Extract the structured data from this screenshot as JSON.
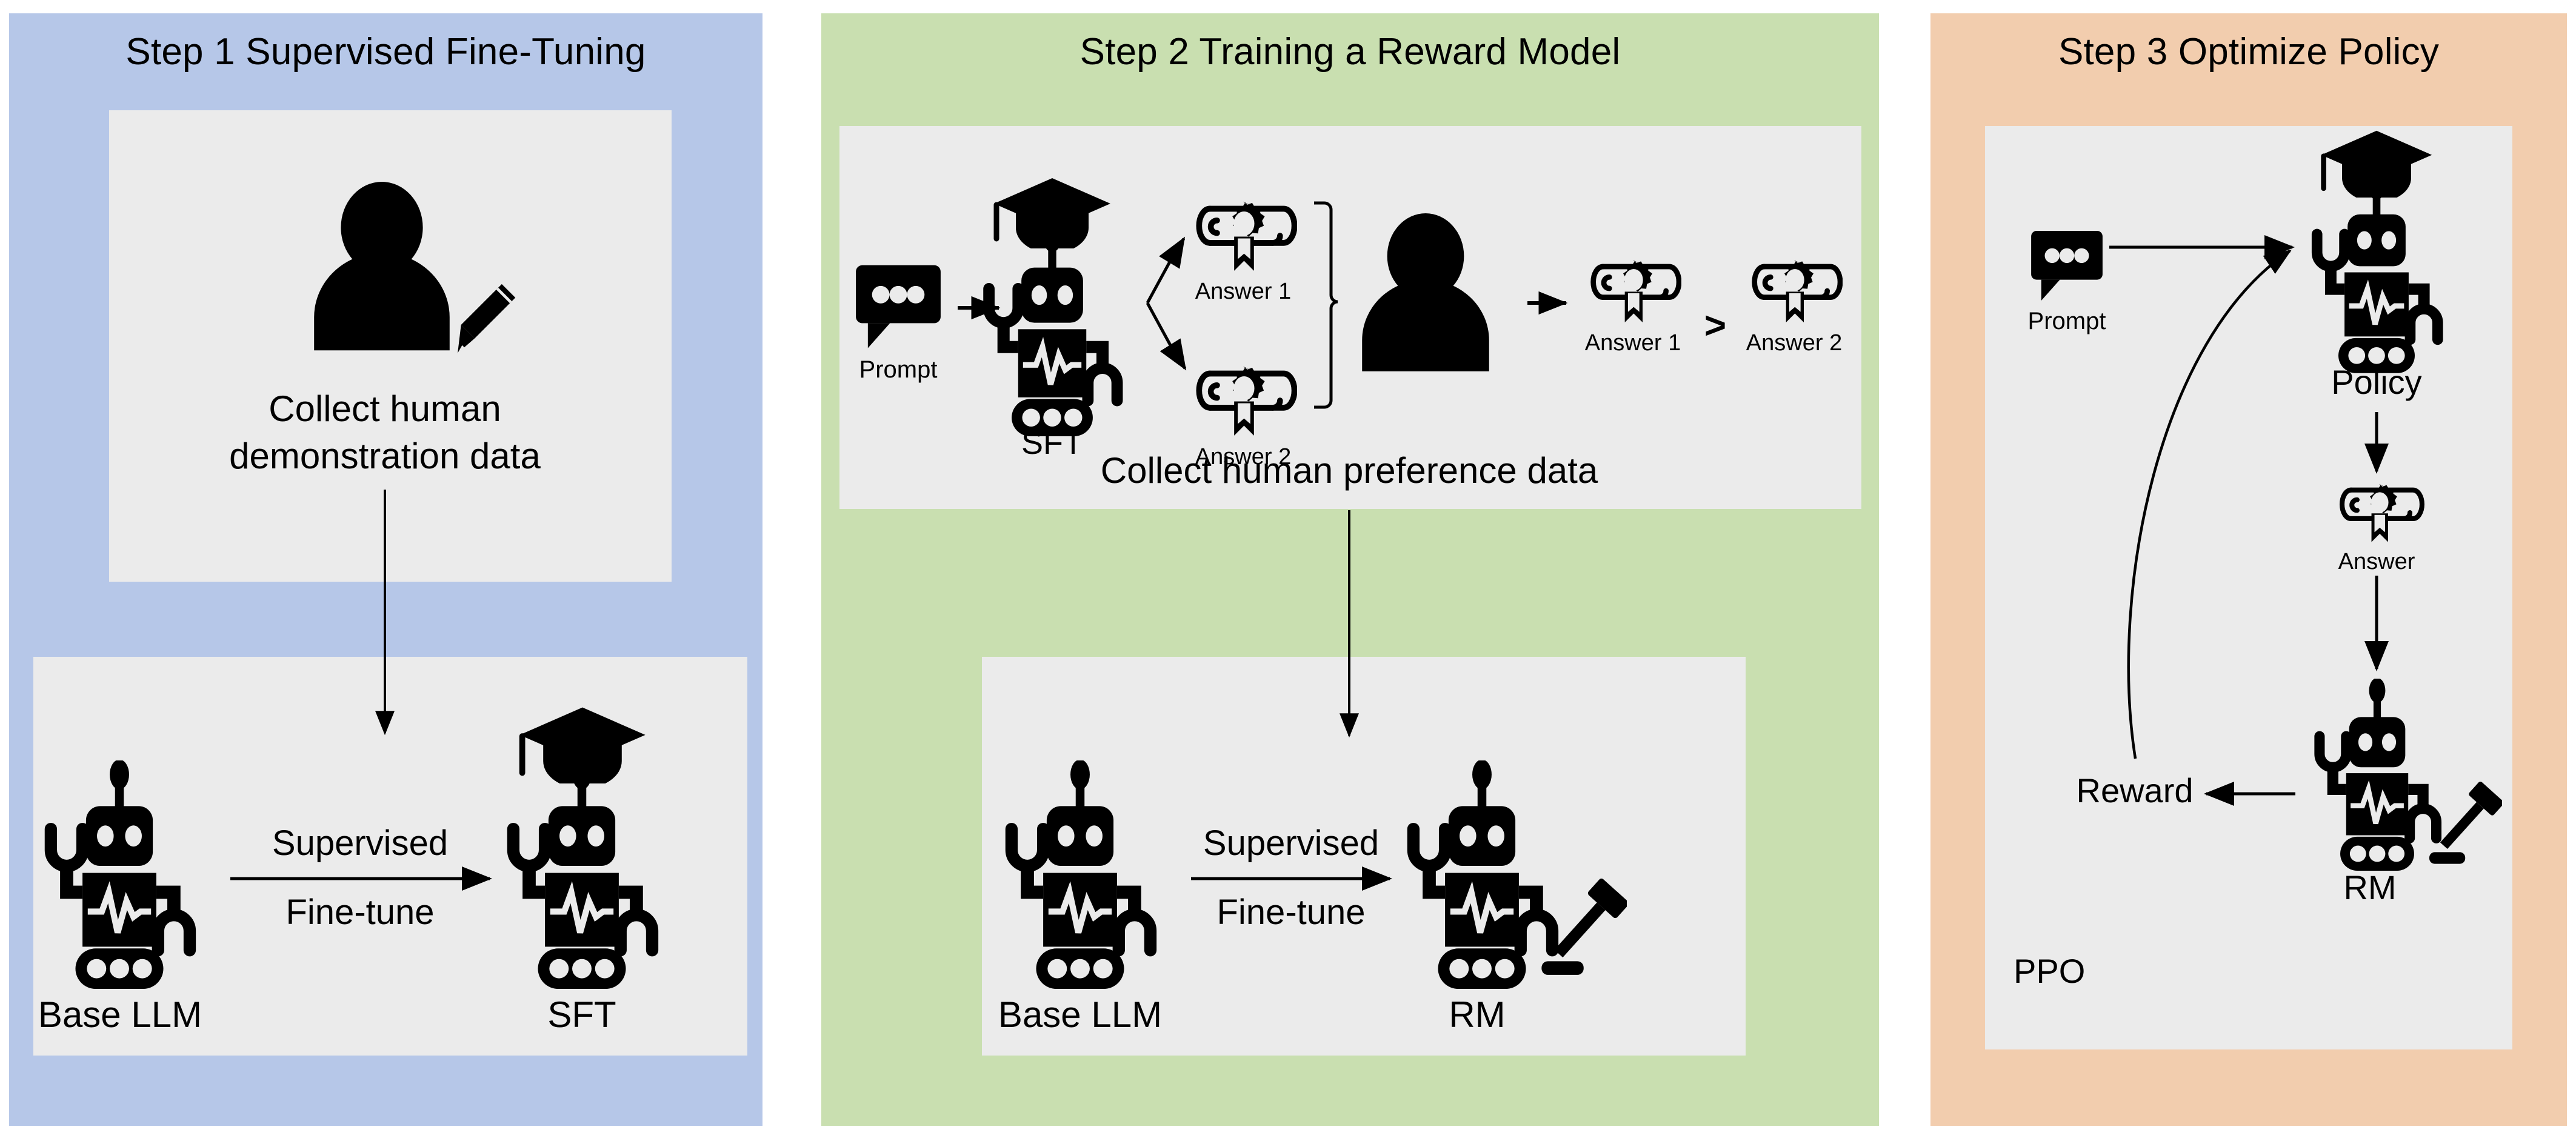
{
  "figure": {
    "title_step1": "Step 1 Supervised Fine-Tuning",
    "title_step2": "Step 2 Training a Reward Model",
    "title_step3": "Step 3 Optimize Policy",
    "colors": {
      "step1_bg": "#b6c7e8",
      "step2_bg": "#c9dfb0",
      "step3_bg": "#f2cdae",
      "card_bg": "#ebebeb",
      "ink": "#000000",
      "page_bg": "#ffffff"
    }
  },
  "step1": {
    "title": "Step 1 Supervised Fine-Tuning",
    "top_card": {
      "person_icon": "person-with-pencil-icon",
      "caption_line1": "Collect human",
      "caption_line2": "demonstration data"
    },
    "bottom_card": {
      "left_icon": "robot-icon",
      "left_label": "Base LLM",
      "arrow_label_line1": "Supervised",
      "arrow_label_line2": "Fine-tune",
      "right_icon": "robot-graduate-icon",
      "right_label": "SFT"
    }
  },
  "step2": {
    "title": "Step 2 Training a Reward Model",
    "top_card": {
      "prompt_icon": "chat-bubble-icon",
      "prompt_label": "Prompt",
      "model_icon": "robot-graduate-icon",
      "model_label": "SFT",
      "answer1_icon": "diploma-scroll-icon",
      "answer1_label": "Answer 1",
      "answer2_icon": "diploma-scroll-icon",
      "answer2_label": "Answer 2",
      "human_icon": "person-icon",
      "ranked_first_icon": "diploma-scroll-icon",
      "ranked_first_label": "Answer 1",
      "comparator": ">",
      "ranked_second_icon": "diploma-scroll-icon",
      "ranked_second_label": "Answer 2",
      "caption": "Collect human preference data"
    },
    "bottom_card": {
      "left_icon": "robot-icon",
      "left_label": "Base LLM",
      "arrow_label_line1": "Supervised",
      "arrow_label_line2": "Fine-tune",
      "right_icon": "robot-gavel-icon",
      "right_label": "RM"
    }
  },
  "step3": {
    "title": "Step 3 Optimize Policy",
    "card": {
      "prompt_icon": "chat-bubble-icon",
      "prompt_label": "Prompt",
      "policy_icon": "robot-graduate-icon",
      "policy_label": "Policy",
      "answer_icon": "diploma-scroll-icon",
      "answer_label": "Answer",
      "rm_icon": "robot-gavel-icon",
      "rm_label": "RM",
      "reward_label": "Reward",
      "algorithm_label": "PPO"
    }
  }
}
